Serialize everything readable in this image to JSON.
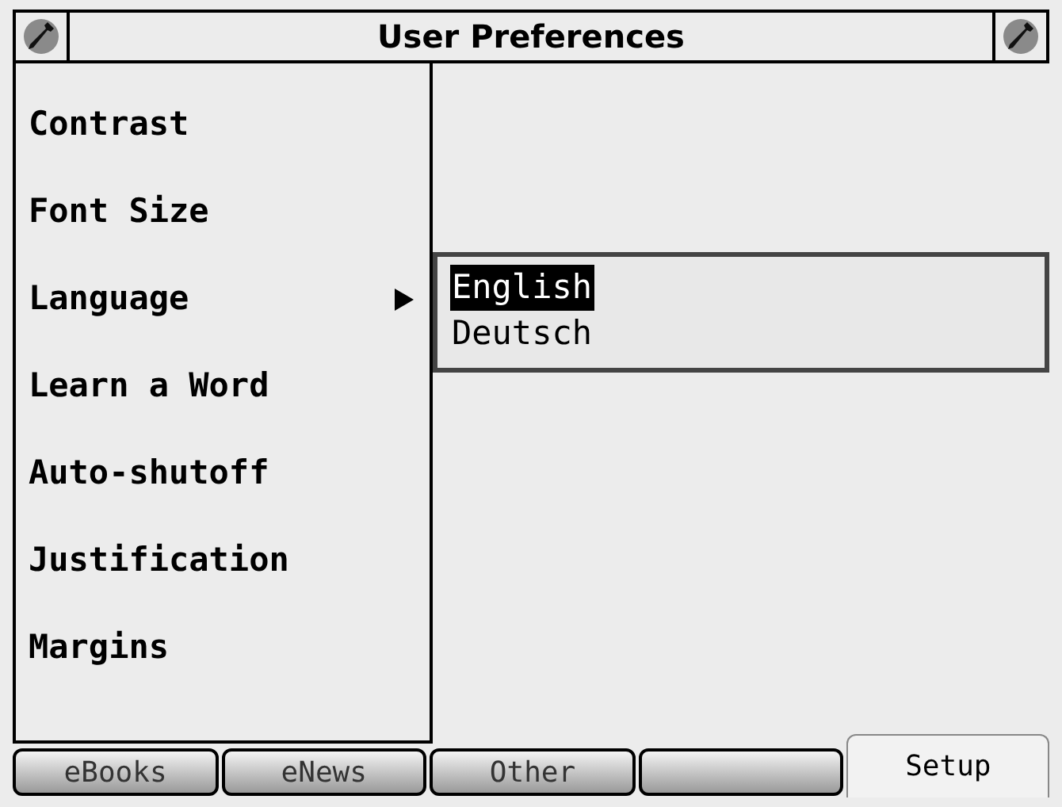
{
  "window": {
    "title": "User Preferences"
  },
  "menu": [
    {
      "label": "Contrast",
      "expanded": false
    },
    {
      "label": "Font Size",
      "expanded": false
    },
    {
      "label": "Language",
      "expanded": true
    },
    {
      "label": "Learn a Word",
      "expanded": false
    },
    {
      "label": "Auto-shutoff",
      "expanded": false
    },
    {
      "label": "Justification",
      "expanded": false
    },
    {
      "label": "Margins",
      "expanded": false
    }
  ],
  "submenu": {
    "options": [
      {
        "label": "English",
        "selected": true
      },
      {
        "label": "Deutsch",
        "selected": false
      }
    ]
  },
  "tabs": [
    {
      "label": "eBooks",
      "selected": false
    },
    {
      "label": "eNews",
      "selected": false
    },
    {
      "label": "Other",
      "selected": false
    },
    {
      "selected": false
    },
    {
      "label": "Setup",
      "selected": true
    }
  ]
}
